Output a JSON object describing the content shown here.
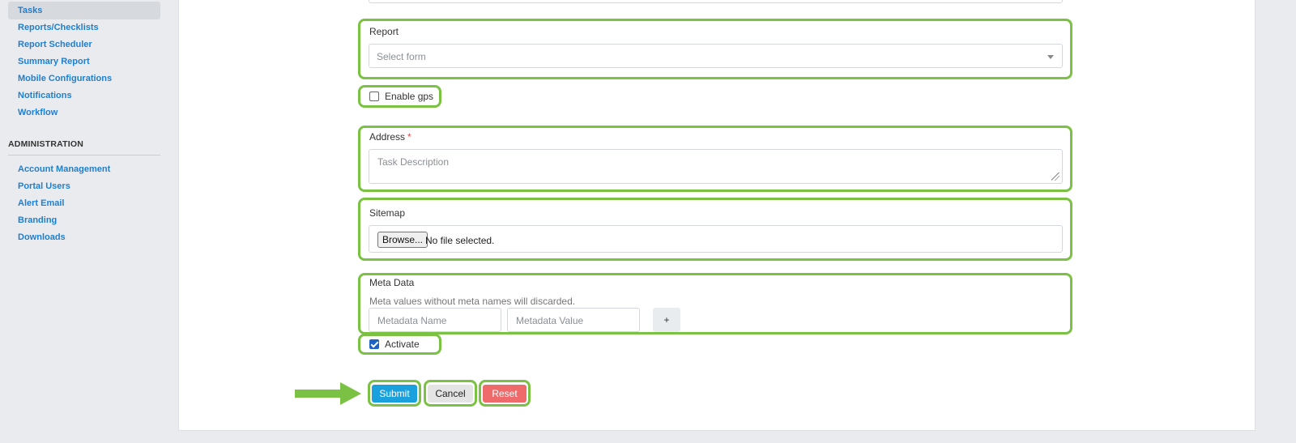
{
  "sidebar": {
    "items": [
      {
        "label": "Tasks",
        "active": true
      },
      {
        "label": "Reports/Checklists"
      },
      {
        "label": "Report Scheduler"
      },
      {
        "label": "Summary Report"
      },
      {
        "label": "Mobile Configurations"
      },
      {
        "label": "Notifications"
      },
      {
        "label": "Workflow"
      }
    ],
    "admin_header": "ADMINISTRATION",
    "admin_items": [
      {
        "label": "Account Management"
      },
      {
        "label": "Portal Users"
      },
      {
        "label": "Alert Email"
      },
      {
        "label": "Branding"
      },
      {
        "label": "Downloads"
      }
    ]
  },
  "form": {
    "report": {
      "label": "Report",
      "placeholder": "Select form"
    },
    "enable_gps": {
      "label": "Enable gps",
      "checked": false
    },
    "address": {
      "label": "Address",
      "required_mark": "*",
      "placeholder": "Task Description"
    },
    "sitemap": {
      "label": "Sitemap",
      "browse_label": "Browse...",
      "file_status": "No file selected."
    },
    "meta": {
      "label": "Meta Data",
      "hint": "Meta values without meta names will discarded.",
      "name_placeholder": "Metadata Name",
      "value_placeholder": "Metadata Value",
      "add_label": "+"
    },
    "activate": {
      "label": "Activate",
      "checked": true
    }
  },
  "actions": {
    "submit": "Submit",
    "cancel": "Cancel",
    "reset": "Reset"
  },
  "colors": {
    "highlight": "#7bc143",
    "link": "#1f7fcf",
    "submit": "#1aa0dc",
    "reset": "#ef6b6b"
  }
}
